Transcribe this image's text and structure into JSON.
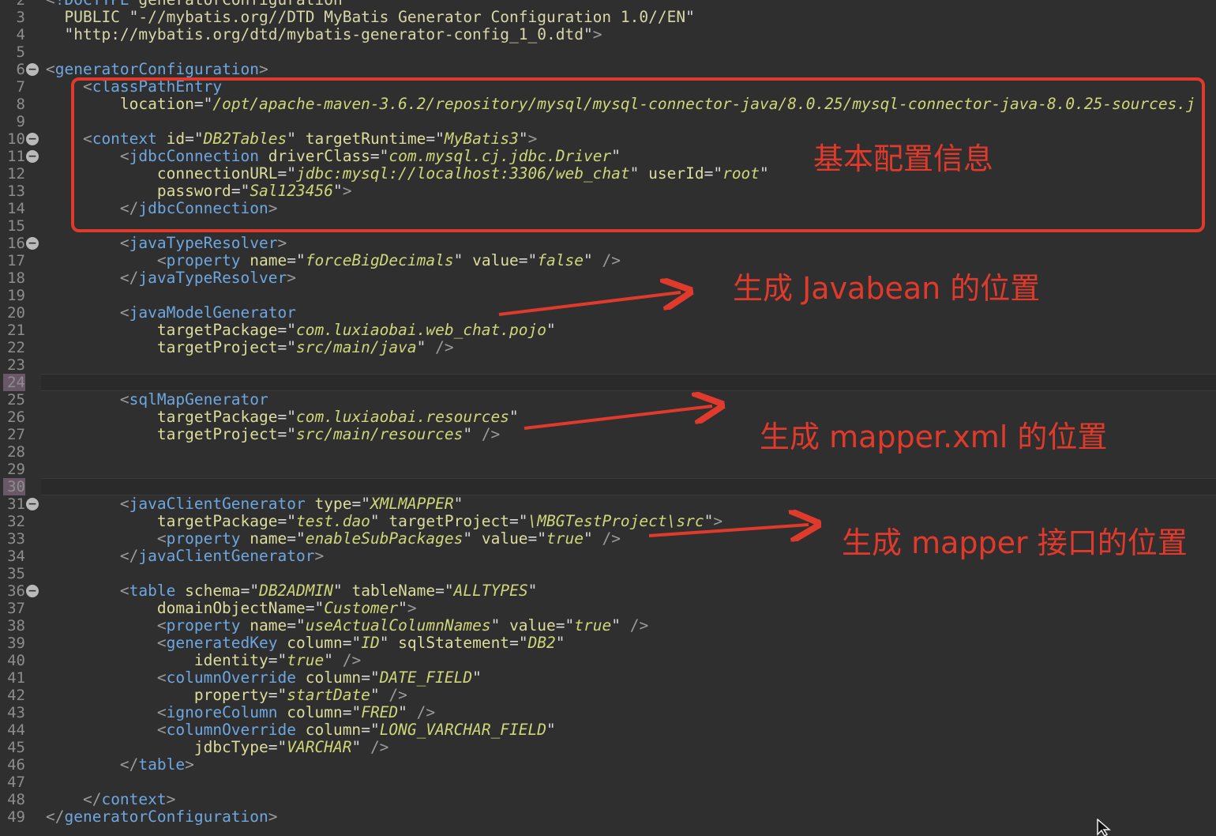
{
  "colors": {
    "annotation": "#e03a2c",
    "background": "#2f2f2f",
    "tag": "#6ea7e0",
    "attr": "#dcdc9c",
    "value": "#cfd67a"
  },
  "lines": [
    {
      "n": "2",
      "parts": [
        [
          "br",
          "<"
        ],
        [
          "tg",
          "!DOCTYPE "
        ],
        [
          "tx",
          "generatorConfiguration"
        ]
      ]
    },
    {
      "n": "3",
      "parts": [
        [
          "dtd",
          "  PUBLIC "
        ],
        [
          "qt",
          "\""
        ],
        [
          "dtd",
          "-//mybatis.org//DTD MyBatis Generator Configuration 1.0//EN"
        ],
        [
          "qt",
          "\""
        ]
      ]
    },
    {
      "n": "4",
      "parts": [
        [
          "qt",
          "  \""
        ],
        [
          "dtd",
          "http://mybatis.org/dtd/mybatis-generator-config_1_0.dtd"
        ],
        [
          "qt",
          "\""
        ],
        [
          "br",
          ">"
        ]
      ]
    },
    {
      "n": "5",
      "parts": []
    },
    {
      "n": "6",
      "parts": [
        [
          "br",
          "<"
        ],
        [
          "tg",
          "generatorConfiguration"
        ],
        [
          "br",
          ">"
        ]
      ]
    },
    {
      "n": "7",
      "parts": [
        [
          "br",
          "    <"
        ],
        [
          "tg",
          "classPathEntry"
        ]
      ]
    },
    {
      "n": "8",
      "parts": [
        [
          "at",
          "        location"
        ],
        [
          "eq",
          "="
        ],
        [
          "qt",
          "\""
        ],
        [
          "vl",
          "/opt/apache-maven-3.6.2/repository/mysql/mysql-connector-java/8.0.25/mysql-connector-java-8.0.25-sources.j"
        ]
      ]
    },
    {
      "n": "9",
      "parts": []
    },
    {
      "n": "10",
      "parts": [
        [
          "br",
          "    <"
        ],
        [
          "tg",
          "context "
        ],
        [
          "at",
          "id"
        ],
        [
          "eq",
          "="
        ],
        [
          "qt",
          "\""
        ],
        [
          "vl",
          "DB2Tables"
        ],
        [
          "qt",
          "\" "
        ],
        [
          "at",
          "targetRuntime"
        ],
        [
          "eq",
          "="
        ],
        [
          "qt",
          "\""
        ],
        [
          "vl",
          "MyBatis3"
        ],
        [
          "qt",
          "\""
        ],
        [
          "br",
          ">"
        ]
      ]
    },
    {
      "n": "11",
      "parts": [
        [
          "br",
          "        <"
        ],
        [
          "tg",
          "jdbcConnection "
        ],
        [
          "at",
          "driverClass"
        ],
        [
          "eq",
          "="
        ],
        [
          "qt",
          "\""
        ],
        [
          "vl",
          "com.mysql.cj.jdbc.Driver"
        ],
        [
          "qt",
          "\""
        ]
      ]
    },
    {
      "n": "12",
      "parts": [
        [
          "at",
          "            connectionURL"
        ],
        [
          "eq",
          "="
        ],
        [
          "qt",
          "\""
        ],
        [
          "vl",
          "jdbc:mysql://localhost:3306/web_chat"
        ],
        [
          "qt",
          "\" "
        ],
        [
          "at",
          "userId"
        ],
        [
          "eq",
          "="
        ],
        [
          "qt",
          "\""
        ],
        [
          "vl",
          "root"
        ],
        [
          "qt",
          "\""
        ]
      ]
    },
    {
      "n": "13",
      "parts": [
        [
          "at",
          "            password"
        ],
        [
          "eq",
          "="
        ],
        [
          "qt",
          "\""
        ],
        [
          "vl",
          "Sal123456"
        ],
        [
          "qt",
          "\""
        ],
        [
          "br",
          ">"
        ]
      ]
    },
    {
      "n": "14",
      "parts": [
        [
          "br",
          "        </"
        ],
        [
          "tg",
          "jdbcConnection"
        ],
        [
          "br",
          ">"
        ]
      ]
    },
    {
      "n": "15",
      "parts": []
    },
    {
      "n": "16",
      "parts": [
        [
          "br",
          "        <"
        ],
        [
          "tg",
          "javaTypeResolver"
        ],
        [
          "br",
          ">"
        ]
      ]
    },
    {
      "n": "17",
      "parts": [
        [
          "br",
          "            <"
        ],
        [
          "tg",
          "property "
        ],
        [
          "at",
          "name"
        ],
        [
          "eq",
          "="
        ],
        [
          "qt",
          "\""
        ],
        [
          "vl",
          "forceBigDecimals"
        ],
        [
          "qt",
          "\" "
        ],
        [
          "at",
          "value"
        ],
        [
          "eq",
          "="
        ],
        [
          "qt",
          "\""
        ],
        [
          "vl",
          "false"
        ],
        [
          "qt",
          "\" "
        ],
        [
          "br",
          "/>"
        ]
      ]
    },
    {
      "n": "18",
      "parts": [
        [
          "br",
          "        </"
        ],
        [
          "tg",
          "javaTypeResolver"
        ],
        [
          "br",
          ">"
        ]
      ]
    },
    {
      "n": "19",
      "parts": []
    },
    {
      "n": "20",
      "parts": [
        [
          "br",
          "        <"
        ],
        [
          "tg",
          "javaModelGenerator"
        ]
      ]
    },
    {
      "n": "21",
      "parts": [
        [
          "at",
          "            targetPackage"
        ],
        [
          "eq",
          "="
        ],
        [
          "qt",
          "\""
        ],
        [
          "vl",
          "com.luxiaobai.web_chat.pojo"
        ],
        [
          "qt",
          "\""
        ]
      ]
    },
    {
      "n": "22",
      "parts": [
        [
          "at",
          "            targetProject"
        ],
        [
          "eq",
          "="
        ],
        [
          "qt",
          "\""
        ],
        [
          "vl",
          "src/main/java"
        ],
        [
          "qt",
          "\" "
        ],
        [
          "br",
          "/>"
        ]
      ]
    },
    {
      "n": "23",
      "parts": []
    },
    {
      "n": "24",
      "parts": []
    },
    {
      "n": "25",
      "parts": [
        [
          "br",
          "        <"
        ],
        [
          "tg",
          "sqlMapGenerator"
        ]
      ]
    },
    {
      "n": "26",
      "parts": [
        [
          "at",
          "            targetPackage"
        ],
        [
          "eq",
          "="
        ],
        [
          "qt",
          "\""
        ],
        [
          "vl",
          "com.luxiaobai.resources"
        ],
        [
          "qt",
          "\""
        ]
      ]
    },
    {
      "n": "27",
      "parts": [
        [
          "at",
          "            targetProject"
        ],
        [
          "eq",
          "="
        ],
        [
          "qt",
          "\""
        ],
        [
          "vl",
          "src/main/resources"
        ],
        [
          "qt",
          "\" "
        ],
        [
          "br",
          "/>"
        ]
      ]
    },
    {
      "n": "28",
      "parts": []
    },
    {
      "n": "29",
      "parts": []
    },
    {
      "n": "30",
      "parts": []
    },
    {
      "n": "31",
      "parts": [
        [
          "br",
          "        <"
        ],
        [
          "tg",
          "javaClientGenerator "
        ],
        [
          "at",
          "type"
        ],
        [
          "eq",
          "="
        ],
        [
          "qt",
          "\""
        ],
        [
          "vl",
          "XMLMAPPER"
        ],
        [
          "qt",
          "\""
        ]
      ]
    },
    {
      "n": "32",
      "parts": [
        [
          "at",
          "            targetPackage"
        ],
        [
          "eq",
          "="
        ],
        [
          "qt",
          "\""
        ],
        [
          "vl",
          "test.dao"
        ],
        [
          "qt",
          "\" "
        ],
        [
          "at",
          "targetProject"
        ],
        [
          "eq",
          "="
        ],
        [
          "qt",
          "\""
        ],
        [
          "vl",
          "\\MBGTestProject\\src"
        ],
        [
          "qt",
          "\""
        ],
        [
          "br",
          ">"
        ]
      ]
    },
    {
      "n": "33",
      "parts": [
        [
          "br",
          "            <"
        ],
        [
          "tg",
          "property "
        ],
        [
          "at",
          "name"
        ],
        [
          "eq",
          "="
        ],
        [
          "qt",
          "\""
        ],
        [
          "vl",
          "enableSubPackages"
        ],
        [
          "qt",
          "\" "
        ],
        [
          "at",
          "value"
        ],
        [
          "eq",
          "="
        ],
        [
          "qt",
          "\""
        ],
        [
          "vl",
          "true"
        ],
        [
          "qt",
          "\" "
        ],
        [
          "br",
          "/>"
        ]
      ]
    },
    {
      "n": "34",
      "parts": [
        [
          "br",
          "        </"
        ],
        [
          "tg",
          "javaClientGenerator"
        ],
        [
          "br",
          ">"
        ]
      ]
    },
    {
      "n": "35",
      "parts": []
    },
    {
      "n": "36",
      "parts": [
        [
          "br",
          "        <"
        ],
        [
          "tg",
          "table "
        ],
        [
          "at",
          "schema"
        ],
        [
          "eq",
          "="
        ],
        [
          "qt",
          "\""
        ],
        [
          "vl",
          "DB2ADMIN"
        ],
        [
          "qt",
          "\" "
        ],
        [
          "at",
          "tableName"
        ],
        [
          "eq",
          "="
        ],
        [
          "qt",
          "\""
        ],
        [
          "vl",
          "ALLTYPES"
        ],
        [
          "qt",
          "\""
        ]
      ]
    },
    {
      "n": "37",
      "parts": [
        [
          "at",
          "            domainObjectName"
        ],
        [
          "eq",
          "="
        ],
        [
          "qt",
          "\""
        ],
        [
          "vl",
          "Customer"
        ],
        [
          "qt",
          "\""
        ],
        [
          "br",
          ">"
        ]
      ]
    },
    {
      "n": "38",
      "parts": [
        [
          "br",
          "            <"
        ],
        [
          "tg",
          "property "
        ],
        [
          "at",
          "name"
        ],
        [
          "eq",
          "="
        ],
        [
          "qt",
          "\""
        ],
        [
          "vl",
          "useActualColumnNames"
        ],
        [
          "qt",
          "\" "
        ],
        [
          "at",
          "value"
        ],
        [
          "eq",
          "="
        ],
        [
          "qt",
          "\""
        ],
        [
          "vl",
          "true"
        ],
        [
          "qt",
          "\" "
        ],
        [
          "br",
          "/>"
        ]
      ]
    },
    {
      "n": "39",
      "parts": [
        [
          "br",
          "            <"
        ],
        [
          "tg",
          "generatedKey "
        ],
        [
          "at",
          "column"
        ],
        [
          "eq",
          "="
        ],
        [
          "qt",
          "\""
        ],
        [
          "vl",
          "ID"
        ],
        [
          "qt",
          "\" "
        ],
        [
          "at",
          "sqlStatement"
        ],
        [
          "eq",
          "="
        ],
        [
          "qt",
          "\""
        ],
        [
          "vl",
          "DB2"
        ],
        [
          "qt",
          "\""
        ]
      ]
    },
    {
      "n": "40",
      "parts": [
        [
          "at",
          "                identity"
        ],
        [
          "eq",
          "="
        ],
        [
          "qt",
          "\""
        ],
        [
          "vl",
          "true"
        ],
        [
          "qt",
          "\" "
        ],
        [
          "br",
          "/>"
        ]
      ]
    },
    {
      "n": "41",
      "parts": [
        [
          "br",
          "            <"
        ],
        [
          "tg",
          "columnOverride "
        ],
        [
          "at",
          "column"
        ],
        [
          "eq",
          "="
        ],
        [
          "qt",
          "\""
        ],
        [
          "vl",
          "DATE_FIELD"
        ],
        [
          "qt",
          "\""
        ]
      ]
    },
    {
      "n": "42",
      "parts": [
        [
          "at",
          "                property"
        ],
        [
          "eq",
          "="
        ],
        [
          "qt",
          "\""
        ],
        [
          "vl",
          "startDate"
        ],
        [
          "qt",
          "\" "
        ],
        [
          "br",
          "/>"
        ]
      ]
    },
    {
      "n": "43",
      "parts": [
        [
          "br",
          "            <"
        ],
        [
          "tg",
          "ignoreColumn "
        ],
        [
          "at",
          "column"
        ],
        [
          "eq",
          "="
        ],
        [
          "qt",
          "\""
        ],
        [
          "vl",
          "FRED"
        ],
        [
          "qt",
          "\" "
        ],
        [
          "br",
          "/>"
        ]
      ]
    },
    {
      "n": "44",
      "parts": [
        [
          "br",
          "            <"
        ],
        [
          "tg",
          "columnOverride "
        ],
        [
          "at",
          "column"
        ],
        [
          "eq",
          "="
        ],
        [
          "qt",
          "\""
        ],
        [
          "vl",
          "LONG_VARCHAR_FIELD"
        ],
        [
          "qt",
          "\""
        ]
      ]
    },
    {
      "n": "45",
      "parts": [
        [
          "at",
          "                jdbcType"
        ],
        [
          "eq",
          "="
        ],
        [
          "qt",
          "\""
        ],
        [
          "vl",
          "VARCHAR"
        ],
        [
          "qt",
          "\" "
        ],
        [
          "br",
          "/>"
        ]
      ]
    },
    {
      "n": "46",
      "parts": [
        [
          "br",
          "        </"
        ],
        [
          "tg",
          "table"
        ],
        [
          "br",
          ">"
        ]
      ]
    },
    {
      "n": "47",
      "parts": []
    },
    {
      "n": "48",
      "parts": [
        [
          "br",
          "    </"
        ],
        [
          "tg",
          "context"
        ],
        [
          "br",
          ">"
        ]
      ]
    },
    {
      "n": "49",
      "parts": [
        [
          "br",
          "</"
        ],
        [
          "tg",
          "generatorConfiguration"
        ],
        [
          "br",
          ">"
        ]
      ]
    }
  ],
  "fold_lines": [
    "6",
    "10",
    "11",
    "16",
    "31",
    "36"
  ],
  "highlighted_lines": [
    "24",
    "30"
  ],
  "annotations": {
    "basic_config": "基本配置信息",
    "javabean_location": "生成 Javabean 的位置",
    "mapper_xml_location": "生成 mapper.xml 的位置",
    "mapper_interface_location": "生成 mapper 接口的位置"
  }
}
